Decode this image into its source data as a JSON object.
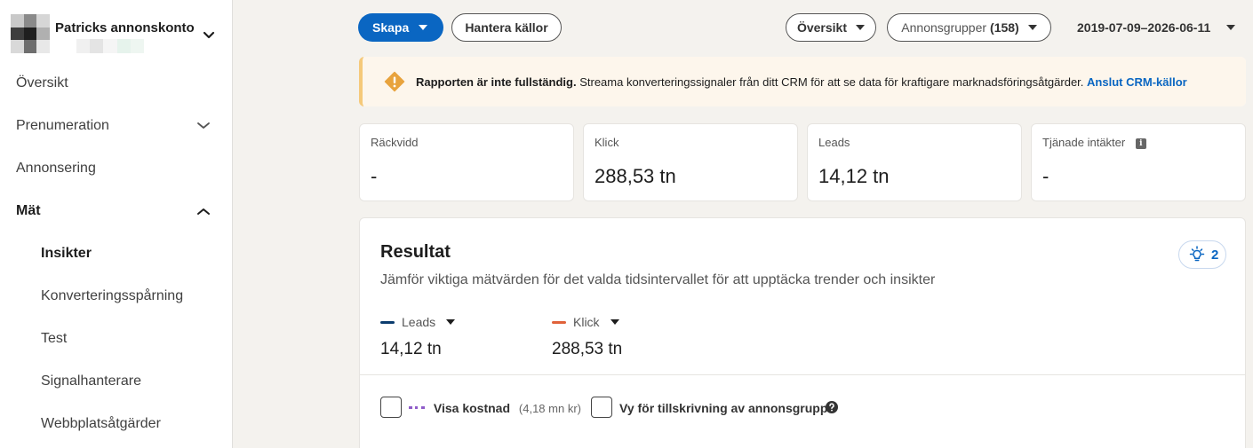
{
  "sidebar": {
    "account_name": "Patricks annonskonto",
    "items": [
      {
        "label": "Översikt"
      },
      {
        "label": "Prenumeration"
      },
      {
        "label": "Annonsering"
      },
      {
        "label": "Mät"
      },
      {
        "label": "Insikter"
      },
      {
        "label": "Konverteringsspårning"
      },
      {
        "label": "Test"
      },
      {
        "label": "Signalhanterare"
      },
      {
        "label": "Webbplatsåtgärder"
      }
    ]
  },
  "toolbar": {
    "create_label": "Skapa",
    "manage_sources_label": "Hantera källor",
    "overview_label": "Översikt",
    "adgroups_label": "Annonsgrupper",
    "adgroups_count": "(158)",
    "date_range": "2019-07-09–2026-06-11"
  },
  "alert": {
    "title": "Rapporten är inte fullständig.",
    "message": "Streama konverteringssignaler från ditt CRM för att se data för kraftigare marknadsföringsåtgärder.",
    "link": "Anslut CRM-källor",
    "color": "#e8a33d"
  },
  "kpis": [
    {
      "label": "Räckvidd",
      "value": "-"
    },
    {
      "label": "Klick",
      "value": "288,53 tn"
    },
    {
      "label": "Leads",
      "value": "14,12 tn"
    },
    {
      "label": "Tjänade intäkter",
      "value": "-"
    }
  ],
  "results": {
    "title": "Resultat",
    "description": "Jämför viktiga mätvärden för det valda tidsintervallet för att upptäcka trender och insikter",
    "insights_count": "2",
    "metrics": [
      {
        "label": "Leads",
        "value": "14,12 tn",
        "color": "#0b3c6e"
      },
      {
        "label": "Klick",
        "value": "288,53 tn",
        "color": "#e0623a"
      }
    ],
    "show_cost_label": "Visa kostnad",
    "show_cost_value": "(4,18 mn kr)",
    "adgroup_view_label": "Vy för tillskrivning av annonsgrupp"
  },
  "colors": {
    "primary": "#0a66c2",
    "cost_line": "#8f5cc9"
  }
}
